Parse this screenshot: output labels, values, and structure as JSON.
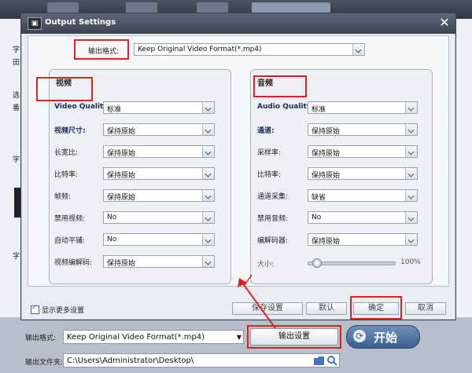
{
  "dialog": {
    "title": "Output Settings",
    "close": "✕",
    "output_format_label": "输出格式:",
    "output_format_value": "Keep Original Video Format(*.mp4)"
  },
  "video": {
    "title": "视频",
    "rows": [
      {
        "label": "Video Quality:",
        "value": "标准"
      },
      {
        "label": "视频尺寸:",
        "value": "保持原始"
      },
      {
        "label": "长宽比:",
        "value": "保持原始"
      },
      {
        "label": "比特率:",
        "value": "保持原始"
      },
      {
        "label": "帧频:",
        "value": "保持原始"
      },
      {
        "label": "禁用视频:",
        "value": "No"
      },
      {
        "label": "自动平铺:",
        "value": "No"
      },
      {
        "label": "视频编解码:",
        "value": "保持原始"
      }
    ]
  },
  "audio": {
    "title": "音频",
    "rows": [
      {
        "label": "Audio Quality:",
        "value": "标准"
      },
      {
        "label": "通道:",
        "value": "保持原始"
      },
      {
        "label": "采样率:",
        "value": "保持原始"
      },
      {
        "label": "比特率:",
        "value": "保持原始"
      },
      {
        "label": "通道采集:",
        "value": "缺省"
      },
      {
        "label": "禁用音频:",
        "value": "No"
      },
      {
        "label": "编解码器:",
        "value": "保持原始"
      }
    ],
    "volume_label": "大小:",
    "volume_value": "100%",
    "volume_fraction": 0.1
  },
  "footer": {
    "show_more": "显示更多设置",
    "save": "保存设置",
    "default": "默认",
    "ok": "确定",
    "cancel": "取消"
  },
  "main": {
    "output_format_label": "输出格式:",
    "output_format_value": "Keep Original Video Format(*.mp4)",
    "output_settings_button": "输出设置",
    "output_folder_label": "输出文件夹:",
    "output_folder_value": "C:\\Users\\Administrator\\Desktop\\",
    "start": "开始",
    "left_strip": [
      "字",
      "田",
      "选",
      "番",
      "字",
      "字"
    ]
  },
  "colors": {
    "highlight": "#e02020",
    "accent": "#3d5f8f"
  },
  "icons": [
    "app-icon",
    "close-icon",
    "chevron-down-icon",
    "folder-icon",
    "search-icon",
    "refresh-icon"
  ]
}
